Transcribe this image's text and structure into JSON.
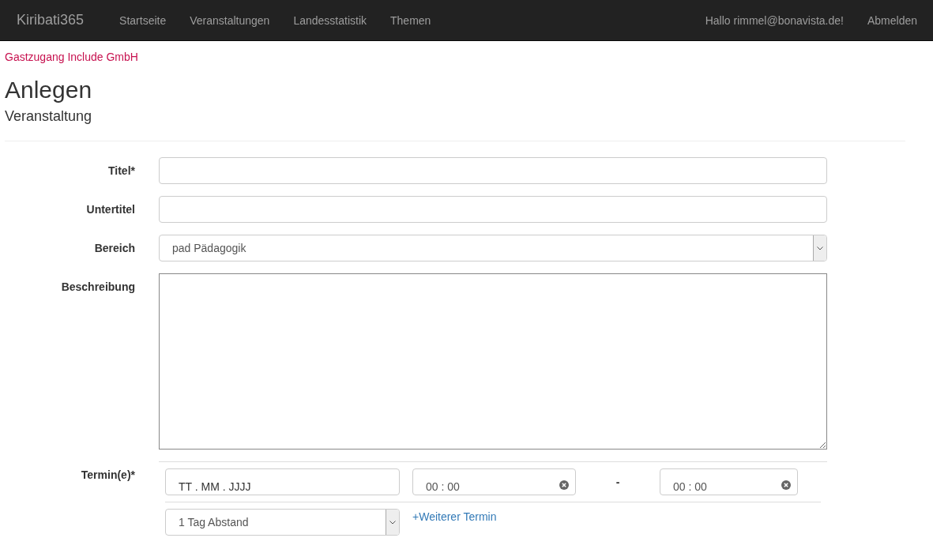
{
  "navbar": {
    "brand": "Kiribati365",
    "links": [
      "Startseite",
      "Veranstaltungen",
      "Landesstatistik",
      "Themen"
    ],
    "greeting": "Hallo rimmel@bonavista.de!",
    "logout": "Abmelden"
  },
  "account": "Gastzugang Include GmbH",
  "heading": "Anlegen",
  "subheading": "Veranstaltung",
  "form": {
    "fields": [
      {
        "kind": "text",
        "label": "Titel*"
      },
      {
        "kind": "text",
        "label": "Untertitel"
      },
      {
        "kind": "select",
        "label": "Bereich",
        "value": "pad Pädagogik"
      },
      {
        "kind": "textarea",
        "label": "Beschreibung"
      }
    ],
    "dates": {
      "label": "Termin(e)*",
      "date": "TT . MM . JJJJ",
      "start": "00 : 00",
      "separator": "-",
      "end": "00 : 00",
      "interval": "1 Tag Abstand",
      "add_link": "+Weiterer Termin"
    }
  }
}
